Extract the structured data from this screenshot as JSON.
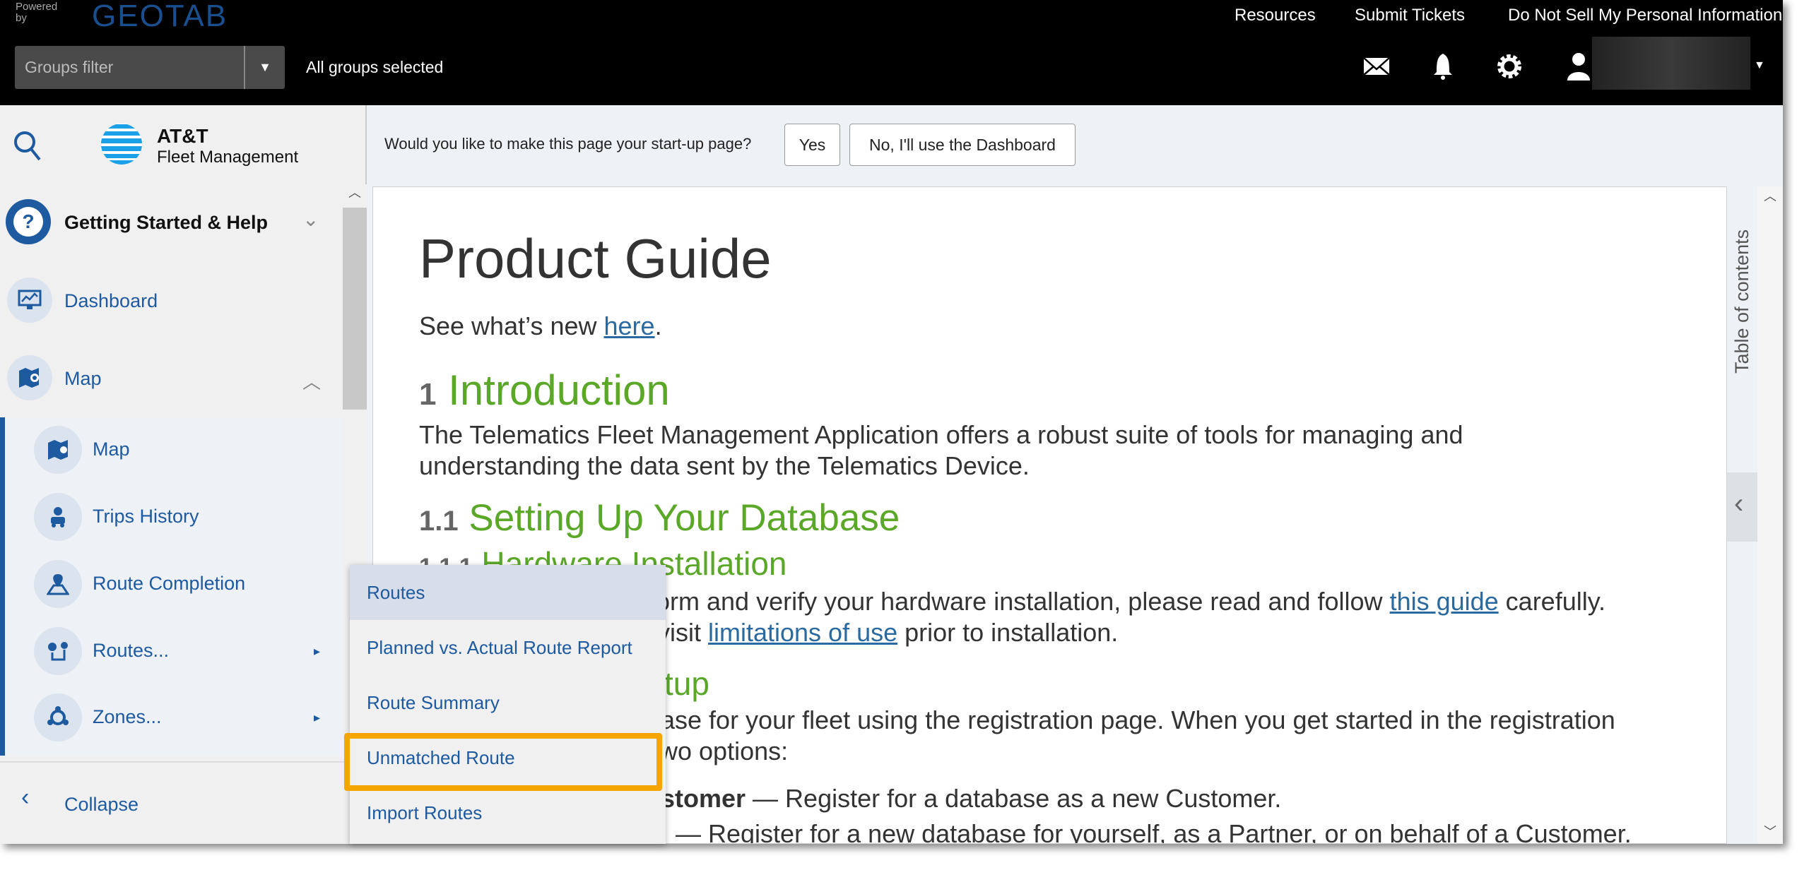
{
  "header": {
    "powered_by": "Powered by",
    "brand": "GEOTAB",
    "links": [
      "Resources",
      "Submit Tickets",
      "Do Not Sell My Personal Information"
    ],
    "groups_filter_placeholder": "Groups filter",
    "groups_status": "All groups selected",
    "icons": [
      "mail-icon",
      "bell-icon",
      "gear-icon",
      "user-icon"
    ]
  },
  "sidebar": {
    "logo_line1": "AT&T",
    "logo_line2": "Fleet Management",
    "items": [
      {
        "label": "Getting Started & Help",
        "icon": "help-icon"
      },
      {
        "label": "Dashboard",
        "icon": "dashboard-icon"
      },
      {
        "label": "Map",
        "icon": "map-icon"
      }
    ],
    "subitems": [
      {
        "label": "Map",
        "icon": "map-icon"
      },
      {
        "label": "Trips History",
        "icon": "trips-icon"
      },
      {
        "label": "Route Completion",
        "icon": "route-completion-icon"
      },
      {
        "label": "Routes...",
        "icon": "routes-icon"
      },
      {
        "label": "Zones...",
        "icon": "zones-icon"
      }
    ],
    "collapse": "Collapse"
  },
  "startup": {
    "question": "Would you like to make this page your start-up page?",
    "yes": "Yes",
    "no": "No, I'll use the Dashboard"
  },
  "doc": {
    "title": "Product Guide",
    "whats_new_pre": "See what’s new ",
    "whats_new_link": "here",
    "whats_new_post": ".",
    "h1_num": "1",
    "h1": "Introduction",
    "intro_l1": "The Telematics Fleet Management Application offers a robust suite of tools for managing and",
    "intro_l2": "understanding the data sent by the Telematics Device.",
    "h2_num": "1.1",
    "h2": "Setting Up Your Database",
    "h3_num": "1.1.1",
    "h3": "Hardware Installation",
    "hw_l1": "orm and verify your hardware installation, please read and follow ",
    "hw_l1_link": "this guide",
    "hw_l1_post": " carefully.",
    "hw_l2": "visit ",
    "hw_l2_link": "limitations of use",
    "hw_l2_post": " prior to installation.",
    "h3b": "tup",
    "reg_l1": "ase for your fleet using the registration page. When you get started in the registration",
    "reg_l2": "wo options:",
    "opt1_bold": "stomer",
    "opt1": " — Register for a database as a new Customer.",
    "opt2": "— Register for a new database for yourself, as a Partner, or on behalf of a Customer.",
    "toc_label": "Table of contents"
  },
  "popup": {
    "items": [
      "Routes",
      "Planned vs. Actual Route Report",
      "Route Summary",
      "Unmatched Route",
      "Import Routes"
    ],
    "highlighted": "Unmatched Route"
  },
  "colors": {
    "accent": "#1e5aa0",
    "heading": "#5ba829",
    "highlight": "#f5a500"
  }
}
